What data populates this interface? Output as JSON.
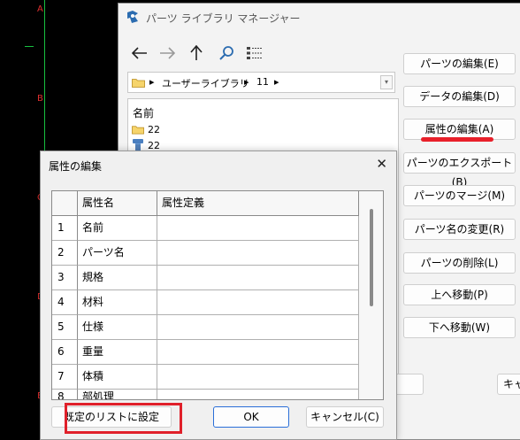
{
  "cad": {
    "letters": [
      "A",
      "B",
      "C",
      "D",
      "E"
    ]
  },
  "parts_manager": {
    "title": "パーツ ライブラリ マネージャー",
    "breadcrumbs": [
      "ユーザーライブラリ",
      "11"
    ],
    "list_header": "名前",
    "items": [
      {
        "name": "22",
        "type": "folder"
      },
      {
        "name": "22",
        "type": "part"
      }
    ],
    "buttons": [
      "パーツの編集(E)",
      "データの編集(D)",
      "属性の編集(A)",
      "パーツのエクスポート(B)",
      "パーツのマージ(M)",
      "パーツ名の変更(R)",
      "パーツの削除(L)",
      "上へ移動(P)",
      "下へ移動(W)"
    ],
    "bottom_cancel_partial": "キャ"
  },
  "attr_dialog": {
    "title": "属性の編集",
    "columns": [
      "属性名",
      "属性定義"
    ],
    "rows": [
      {
        "num": "1",
        "name": "名前",
        "def": ""
      },
      {
        "num": "2",
        "name": "パーツ名",
        "def": ""
      },
      {
        "num": "3",
        "name": "規格",
        "def": ""
      },
      {
        "num": "4",
        "name": "材料",
        "def": ""
      },
      {
        "num": "5",
        "name": "仕様",
        "def": ""
      },
      {
        "num": "6",
        "name": "重量",
        "def": ""
      },
      {
        "num": "7",
        "name": "体積",
        "def": ""
      },
      {
        "num": "8",
        "name": "部処理",
        "def": ""
      }
    ],
    "buttons": {
      "set_default": "既定のリストに設定",
      "ok": "OK",
      "cancel": "キャンセル(C)"
    }
  },
  "colors": {
    "highlight_red": "#e0202a",
    "cad_green": "#18c040",
    "cad_red": "#e03030"
  }
}
